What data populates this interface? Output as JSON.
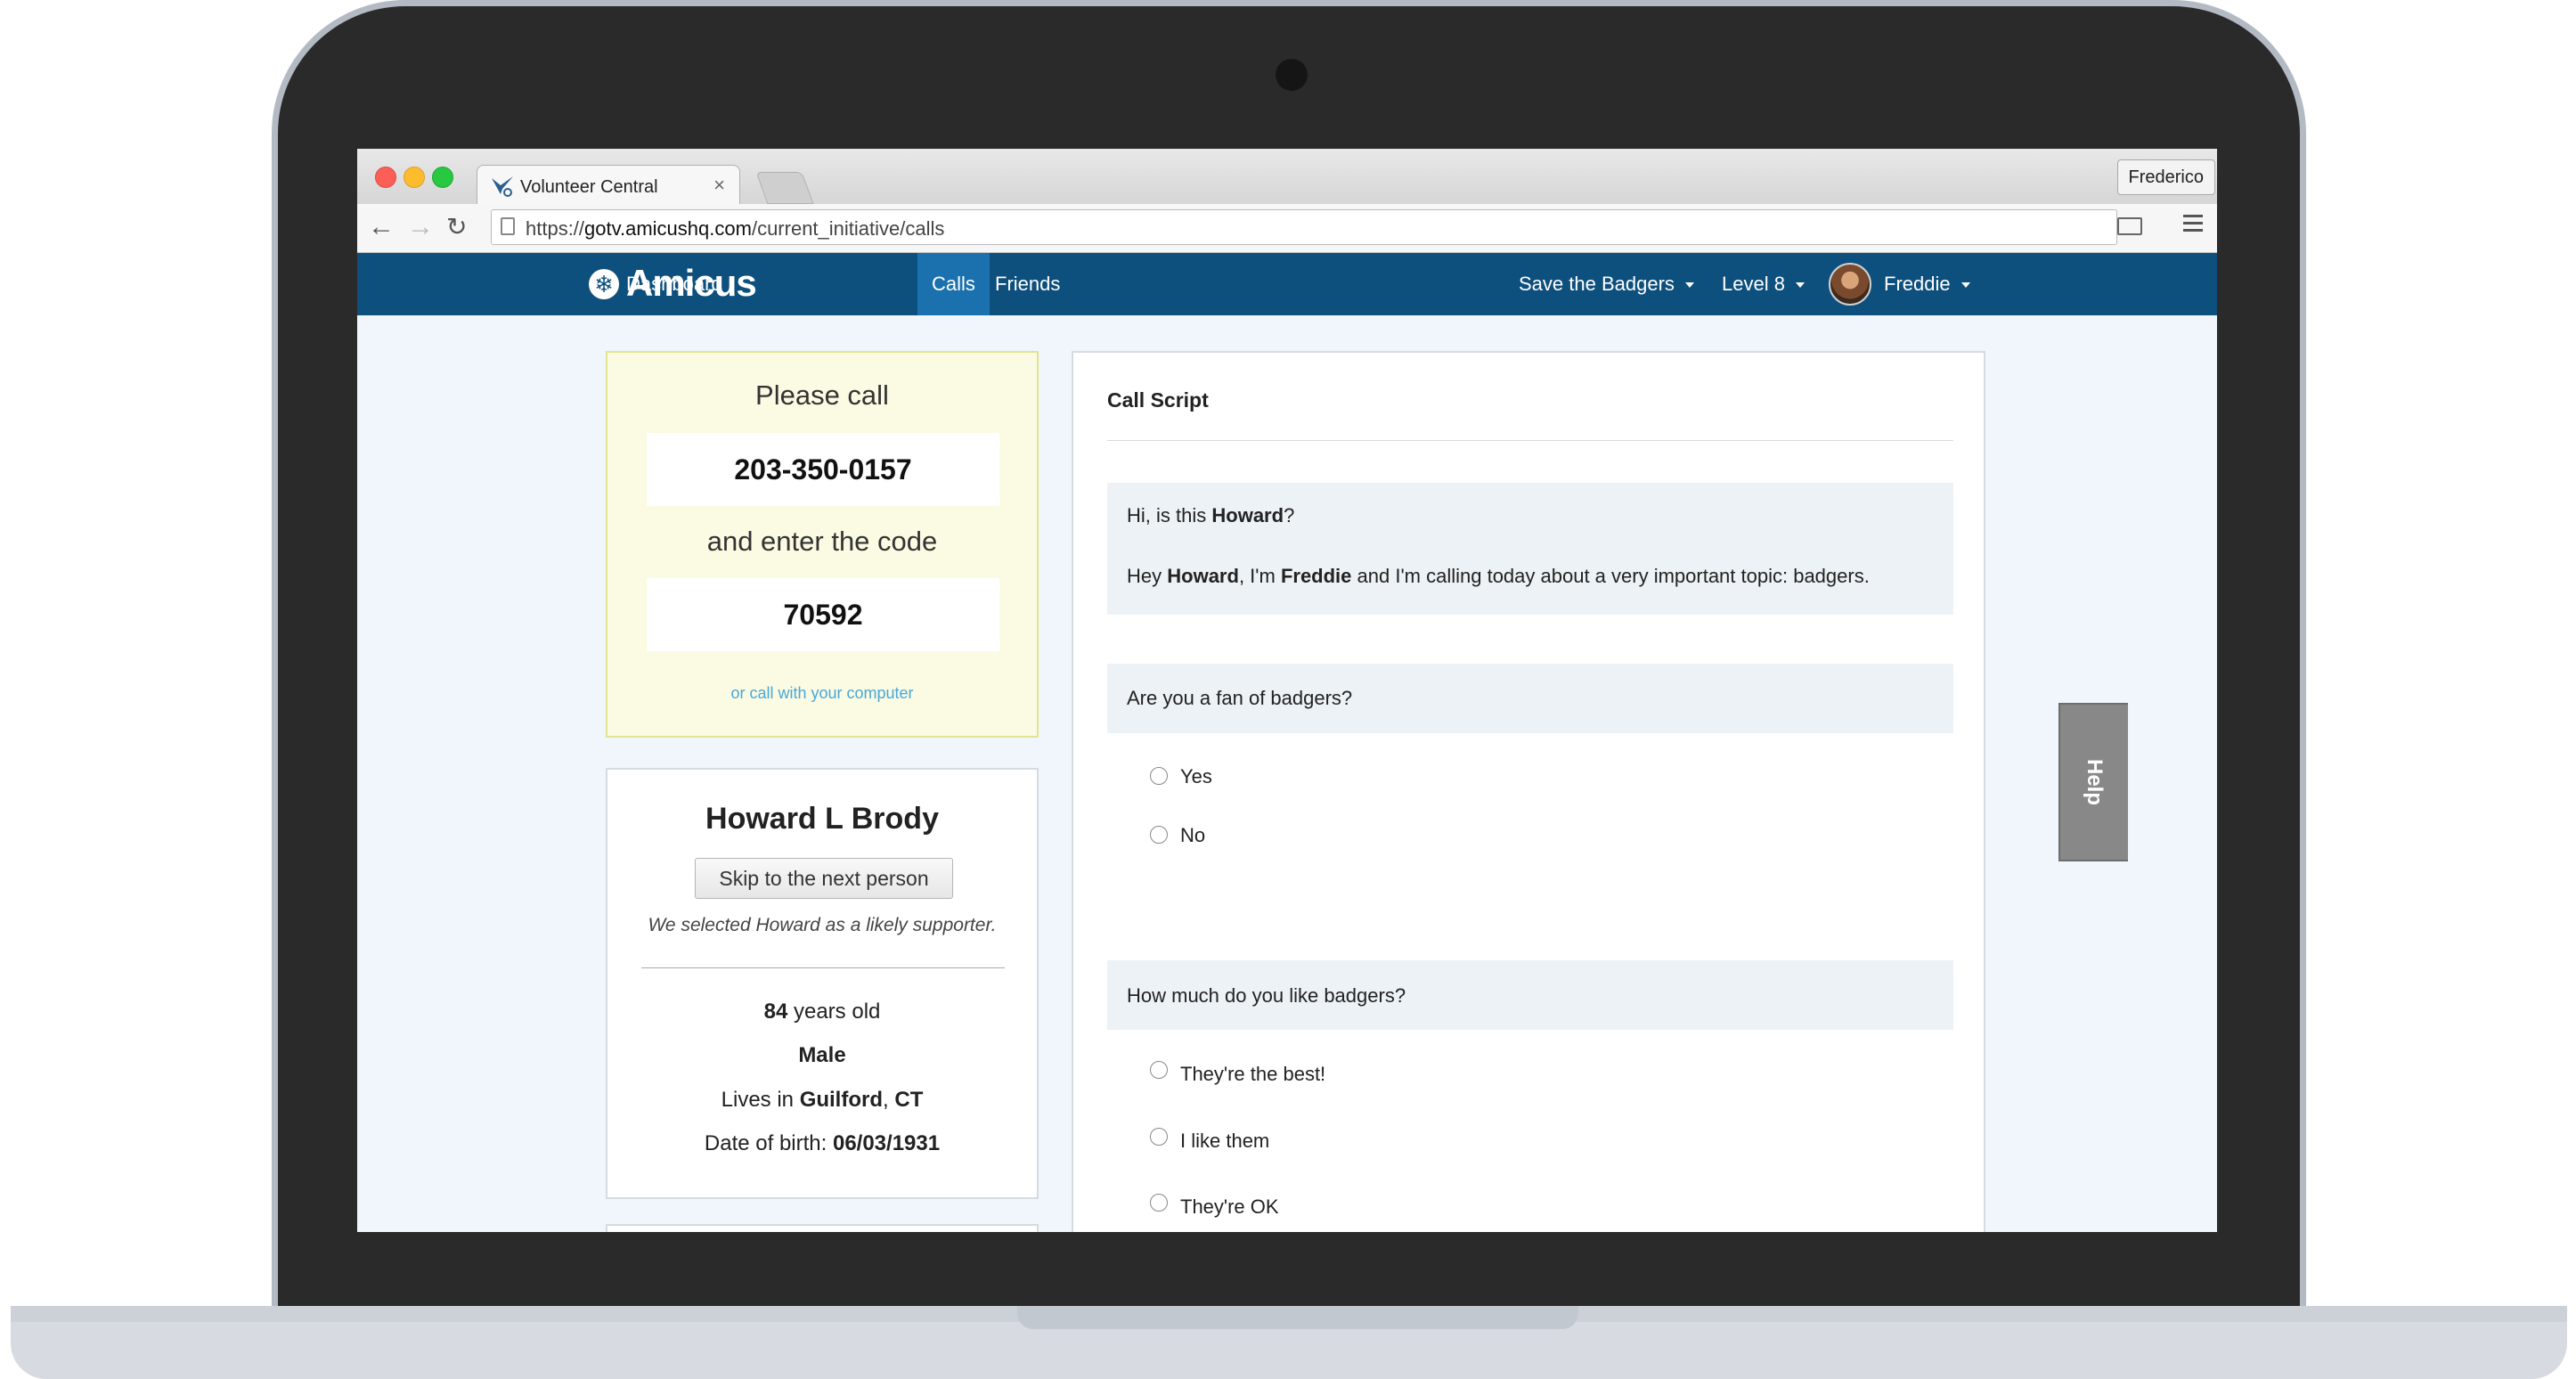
{
  "browser": {
    "tab_title": "Volunteer Central",
    "tab_close": "×",
    "profile": "Frederico",
    "url_scheme": "https://",
    "url_host": "gotv.amicushq.com",
    "url_path": "/current_initiative/calls"
  },
  "nav": {
    "brand": "Amicus",
    "links": [
      "Dashboard",
      "Calls",
      "Friends"
    ],
    "active": "Calls",
    "campaign": "Save the Badgers",
    "level": "Level 8",
    "user": "Freddie",
    "brand_color": "#0d4f7d",
    "active_color": "#1a71ad"
  },
  "call_box": {
    "please_call": "Please call",
    "phone": "203-350-0157",
    "enter_code": "and enter the code",
    "code": "70592",
    "computer_link": "or call with your computer"
  },
  "person": {
    "name": "Howard L Brody",
    "skip_button": "Skip to the next person",
    "note": "We selected Howard as a likely supporter.",
    "age": "84",
    "age_suffix": "years old",
    "gender": "Male",
    "lives_in_label": "Lives in",
    "city": "Guilford",
    "state": "CT",
    "dob_label": "Date of birth:",
    "dob": "06/03/1931"
  },
  "script": {
    "title": "Call Script",
    "greeting_pre": "Hi, is this",
    "contact_name": "Howard",
    "greeting_post": "?",
    "intro_hey": "Hey",
    "intro_im": ", I'm",
    "caller_name": "Freddie",
    "intro_rest": "and I'm calling today about a very important topic: badgers.",
    "q1": {
      "text": "Are you a fan of badgers?",
      "options": [
        "Yes",
        "No"
      ]
    },
    "q2": {
      "text": "How much do you like badgers?",
      "options": [
        "They're the best!",
        "I like them",
        "They're OK"
      ]
    }
  },
  "help": {
    "label": "Help"
  }
}
